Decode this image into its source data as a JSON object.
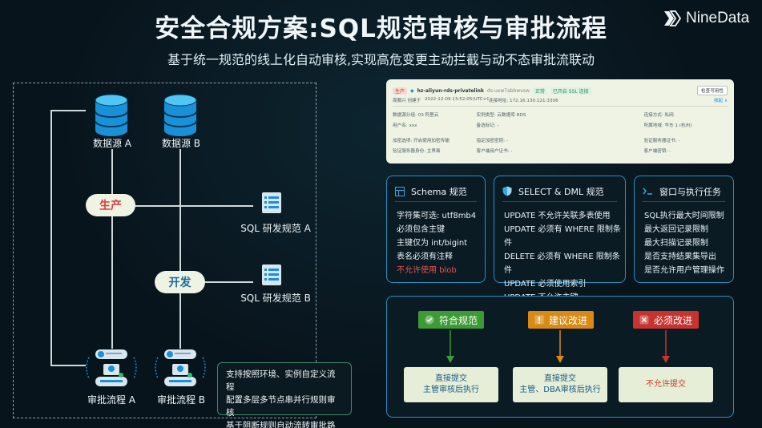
{
  "header": {
    "title": "安全合规方案:SQL规范审核与审批流程",
    "subtitle": "基于统一规范的线上化自动审核,实现高危变更主动拦截与动不态审批流联动",
    "brand": "NineData"
  },
  "diagram": {
    "datasources": [
      "数据源 A",
      "数据源 B"
    ],
    "environments": {
      "prod": "生产",
      "dev": "开发"
    },
    "specs": [
      "SQL 研发规范 A",
      "SQL 研发规范 B"
    ],
    "approvals": [
      "审批流程 A",
      "审批流程 B"
    ],
    "note": [
      "支持按照环境、实例自定义流程",
      "配置多层多节点串并行规则审核",
      "基于阻断规则自动流转审批路由"
    ]
  },
  "screenshot": {
    "tag": "生产",
    "name": "hz-aliyun-rds-privatelink",
    "id": "ds-uxw7abbwvsw",
    "status_cert": "正常",
    "status_conn": "已开启 SSL 连接",
    "button": "检查可用性",
    "creator": "周鹏兴 创建于",
    "created": "2022-12-09 13:52:05(UTC+08:00)",
    "address": "连接地址: 172.16.130.121:3306",
    "collapse": "收起 ∧",
    "rows": [
      [
        "数据源分组: 03 阿里云",
        "实例类型: 云数据库 RDS",
        "",
        "连接方式: 私网"
      ],
      [
        "用户名: xxx",
        "备选标记: -",
        "",
        "所属地域: 华东 1 (杭州)"
      ],
      [
        "加密选项: 开启使用加密传输",
        "指定加密密钥: -",
        "",
        "验证服务器证书: -"
      ],
      [
        "验证服务器身份: 主界面",
        "客户端用户证书: -",
        "",
        "客户端密钥: -"
      ]
    ]
  },
  "cards": [
    {
      "title": "Schema 规范",
      "icon": "table-icon",
      "items": [
        "字符集可选: utf8mb4",
        "必须包含主键",
        "主键仅为 int/bigint",
        "表名必须有注释"
      ],
      "warn": "不允许使用 blob"
    },
    {
      "title": "SELECT & DML 规范",
      "icon": "shield-icon",
      "items": [
        "UPDATE 不允许关联多表使用",
        "UPDATE 必须有 WHERE 限制条件",
        "DELETE 必须有 WHERE 限制条件",
        "UPDATE 必须使用索引",
        "UPDATE 不允许主键"
      ],
      "warn": ""
    },
    {
      "title": "窗口与执行任务",
      "icon": "terminal-icon",
      "items": [
        "SQL执行最大时间限制",
        "最大返回记录限制",
        "最大扫描记录限制",
        "是否支持结果集导出",
        "是否允许用户管理操作"
      ],
      "warn": ""
    }
  ],
  "review": {
    "badges": [
      "符合规范",
      "建议改进",
      "必须改进"
    ],
    "results": [
      [
        "直接提交",
        "主管审核后执行"
      ],
      [
        "直接提交",
        "主管、DBA审核后执行"
      ],
      [
        "不允许提交"
      ]
    ]
  },
  "colors": {
    "green": "#3d9b35",
    "orange": "#d98a14",
    "red": "#c8332f",
    "accent": "#2b8fc0"
  }
}
